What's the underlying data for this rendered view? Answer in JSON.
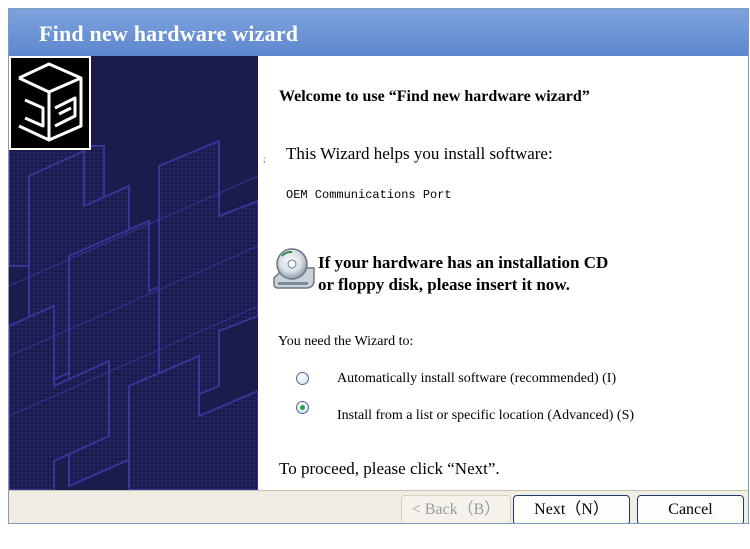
{
  "window": {
    "title": "Find new hardware wizard"
  },
  "sidebar": {
    "icon": "hardware-wizard-icon"
  },
  "content": {
    "welcome": "Welcome to use “Find new hardware wizard”",
    "helps": "This Wizard helps you install software:",
    "device_name": "OEM Communications Port",
    "cd_icon": "cd-drive-icon",
    "cd_line1": "If your hardware has an installation CD",
    "cd_line2": "or floppy disk, please insert it now.",
    "need_label": "You need the Wizard to:",
    "options": [
      {
        "label": "Automatically install software (recommended) (I)",
        "selected": false
      },
      {
        "label": "Install from a list or specific location (Advanced) (S)",
        "selected": true
      }
    ],
    "proceed": "To proceed, please click “Next”."
  },
  "buttons": {
    "back": "< Back（B）",
    "next": "Next（N）",
    "cancel": "Cancel"
  },
  "colors": {
    "title_bar": "#5d87cf",
    "side_panel": "#1c1b4e",
    "button_bar": "#f0ede2",
    "radio_selected": "#23a64a"
  }
}
